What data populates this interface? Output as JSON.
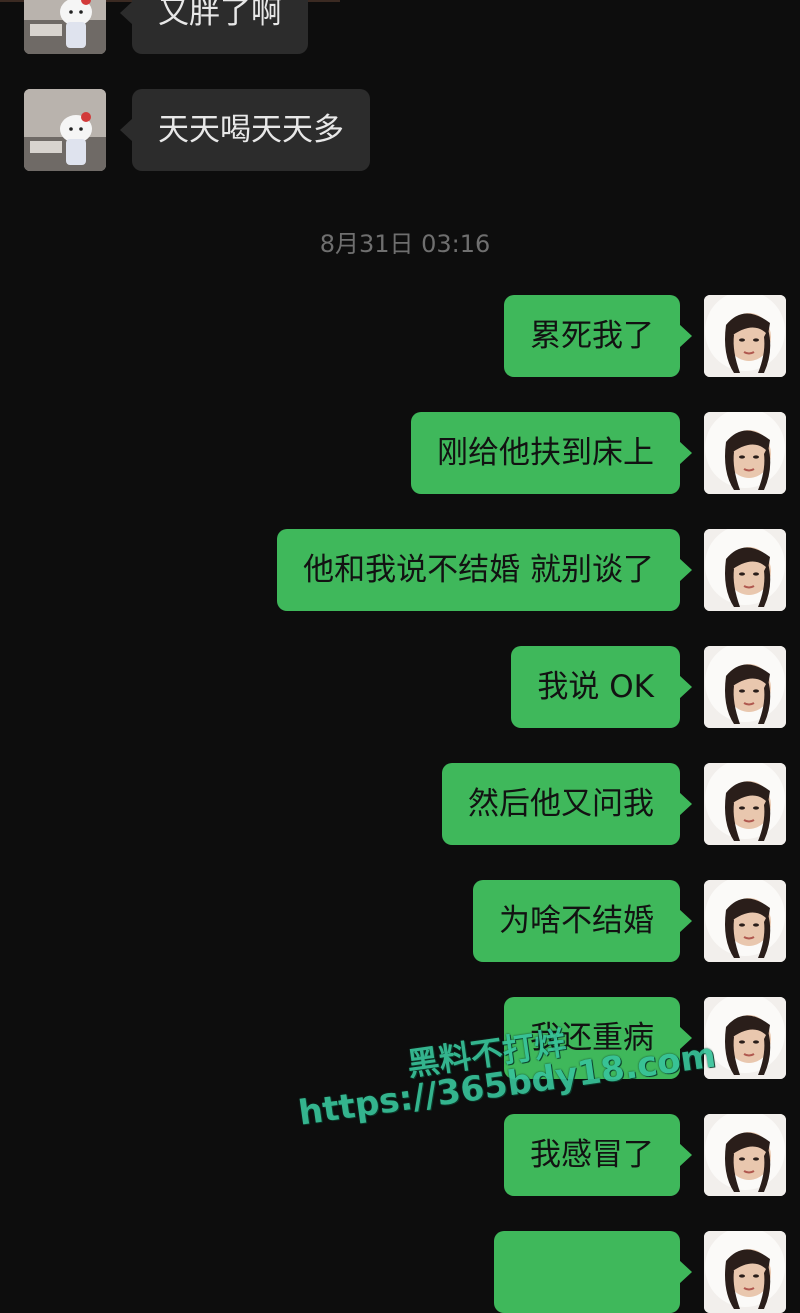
{
  "chat": {
    "incoming": [
      {
        "text": "又胖了啊",
        "avatar": "hello-kitty-photo"
      },
      {
        "text": "天天喝天天多",
        "avatar": "hello-kitty-photo"
      }
    ],
    "timestamp": "8月31日 03:16",
    "outgoing": [
      {
        "text": "累死我了"
      },
      {
        "text": "刚给他扶到床上"
      },
      {
        "text": "他和我说不结婚 就别谈了"
      },
      {
        "text": "我说 OK"
      },
      {
        "text": "然后他又问我"
      },
      {
        "text": "为啥不结婚"
      },
      {
        "text": "我还重病"
      },
      {
        "text": "我感冒了"
      },
      {
        "text": ""
      }
    ]
  },
  "watermark": {
    "line1": "黑料不打烊",
    "line2": "https://365bdy18.com"
  },
  "colors": {
    "background": "#0d0d0d",
    "incoming_bubble": "#2c2c2c",
    "outgoing_bubble": "#3fb85b",
    "timestamp": "#6f6f6f",
    "watermark": "#38c39a"
  }
}
